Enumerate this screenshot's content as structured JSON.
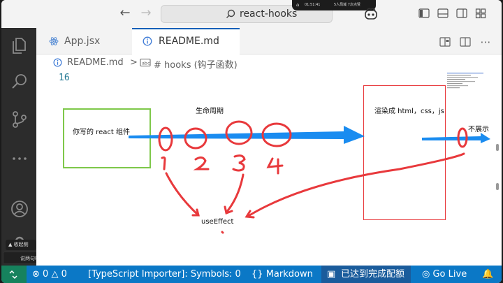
{
  "titlebar": {
    "back_icon": "arrow-left-icon",
    "forward_icon": "arrow-right-icon",
    "search_text": "react-hooks",
    "status_time": "01:51:41",
    "status_people": "5人局域 7次点赞"
  },
  "tabs": [
    {
      "label": "App.jsx",
      "icon": "react-icon",
      "active": false
    },
    {
      "label": "README.md",
      "icon": "info-icon",
      "active": true
    }
  ],
  "breadcrumb": {
    "file": "README.md",
    "separator": ">",
    "section": "# hooks (钩子函数)"
  },
  "editor": {
    "line_number": "16"
  },
  "drawing": {
    "component_label": "你写的 react 组件",
    "lifecycle_label": "生命周期",
    "render_label": "渲染成 html，css，js",
    "hide_label": "不展示",
    "effect_label": "useEffect",
    "numbers": [
      "1",
      "2",
      "3",
      "4"
    ]
  },
  "activity": {
    "tooltip_collapse": "收起侧幕",
    "tooltip_say": "说两句吧~"
  },
  "statusbar": {
    "errors": "0",
    "warnings": "0",
    "importer": "[TypeScript Importer]: Symbols: 0",
    "language": "Markdown",
    "pairing": "已达到完成配额",
    "golive": "Go Live"
  },
  "colors": {
    "statusbar": "#0b78c6",
    "remote": "#16825d",
    "arrow": "#1a8cf0",
    "ink": "#e8393c",
    "green_box": "#7ec84a"
  }
}
